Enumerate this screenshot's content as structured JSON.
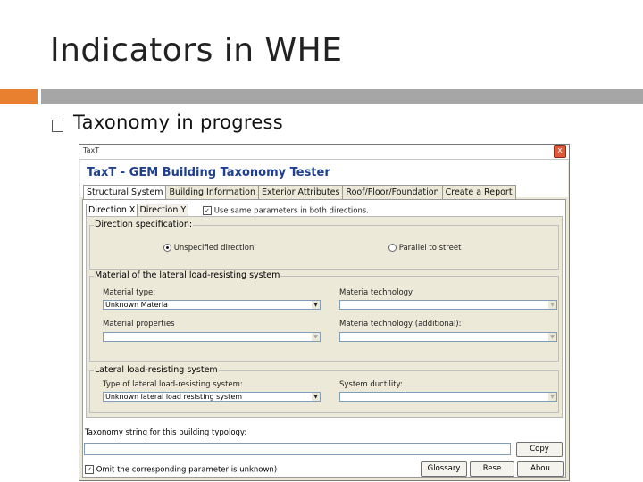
{
  "slide": {
    "title": "Indicators in WHE",
    "bullet": "Taxonomy in progress",
    "accent_color": "#e8802f",
    "bar_color": "#a6a6a6"
  },
  "window": {
    "title": "TaxT",
    "close_label": "x",
    "app_title": "TaxT - GEM Building Taxonomy Tester",
    "tabs": [
      "Structural System",
      "Building Information",
      "Exterior Attributes",
      "Roof/Floor/Foundation",
      "Create a Report"
    ],
    "subtabs": [
      "Direction X",
      "Direction Y"
    ],
    "same_params_check": "✓",
    "same_params_label": "Use same parameters in both directions.",
    "direction_spec": {
      "label": "Direction specification:",
      "unspecified": "Unspecified direction",
      "parallel": "Parallel to street"
    },
    "material": {
      "label": "Material of the lateral load-resisting system",
      "type_label": "Material type:",
      "type_value": "Unknown Materia",
      "technology_label": "Materia technology",
      "properties_label": "Material properties",
      "technology_additional_label": "Materia technology (additional):"
    },
    "lateral": {
      "label": "Lateral load-resisting system",
      "type_label": "Type of lateral load-resisting system:",
      "type_value": "Unknown lateral load resisting system",
      "ductility_label": "System ductility:"
    },
    "taxonomy_string_label": "Taxonomy string for this building typology:",
    "omit_check": "✓",
    "omit_label": "Omit the corresponding parameter is unknown)",
    "buttons": {
      "copy": "Copy",
      "glossary": "Glossary",
      "reset": "Rese",
      "about": "Abou"
    },
    "arrow_icon": "▼"
  }
}
